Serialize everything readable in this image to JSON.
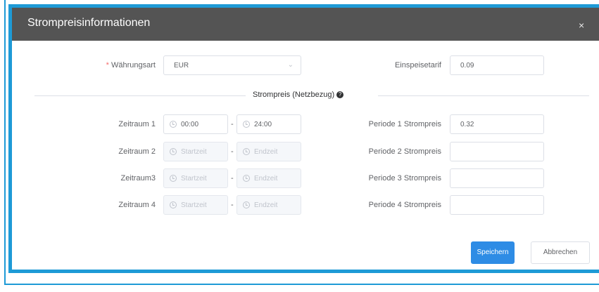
{
  "dialog": {
    "title": "Strompreisinformationen",
    "close_symbol": "×"
  },
  "form": {
    "currency": {
      "required_mark": "*",
      "label": "Währungsart",
      "value": "EUR"
    },
    "feed_in": {
      "label": "Einspeisetarif",
      "value": "0.09"
    },
    "section_title": "Strompreis (Netzbezug)",
    "section_help_symbol": "?",
    "range_separator": "-",
    "periods": [
      {
        "label": "Zeitraum 1",
        "start": "00:00",
        "end": "24:00",
        "enabled": true,
        "price_label": "Periode 1 Strompreis",
        "price": "0.32"
      },
      {
        "label": "Zeitraum 2",
        "start": "Startzeit",
        "end": "Endzeit",
        "enabled": false,
        "price_label": "Periode 2 Strompreis",
        "price": ""
      },
      {
        "label": "Zeitraum3",
        "start": "Startzeit",
        "end": "Endzeit",
        "enabled": false,
        "price_label": "Periode 3 Strompreis",
        "price": ""
      },
      {
        "label": "Zeitraum 4",
        "start": "Startzeit",
        "end": "Endzeit",
        "enabled": false,
        "price_label": "Periode 4 Strompreis",
        "price": ""
      }
    ]
  },
  "buttons": {
    "save": "Speichern",
    "cancel": "Abbrechen"
  },
  "colors": {
    "frame": "#1e9ad6",
    "titlebar": "#545454",
    "primary": "#2e8ce5"
  }
}
